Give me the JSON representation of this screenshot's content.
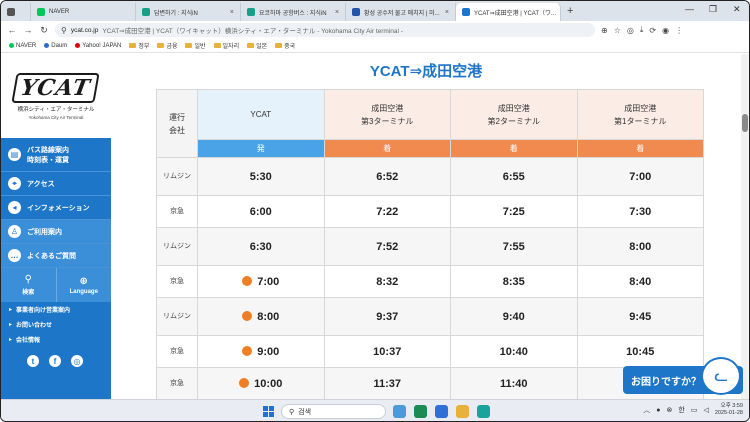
{
  "browser": {
    "tabs": [
      {
        "label": "",
        "favicon_color": "#555555"
      },
      {
        "label": "NAVER",
        "favicon_color": "#03c75a"
      },
      {
        "label": "답변하기 : 지식iN",
        "favicon_color": "#16a085"
      },
      {
        "label": "요코하마 공항버스 : 지식iN",
        "favicon_color": "#16a085"
      },
      {
        "label": "황성 공수저 물고 매치지 | 미...",
        "favicon_color": "#2255aa"
      },
      {
        "label": "YCAT⇒成田空港 | YCAT（ワ...",
        "favicon_color": "#1e76c8"
      }
    ],
    "address": {
      "domain": "ycat.co.jp",
      "rest": "YCAT⇒成田空港 | YCAT（ワイキャット）横浜シティ・エア・ターミナル - Yokohama City Air terminal -"
    },
    "bookmarks": [
      {
        "label": "NAVER",
        "icon": "dot",
        "color": "#03c75a"
      },
      {
        "label": "Daum",
        "icon": "dot",
        "color": "#2a6bd1"
      },
      {
        "label": "Yahoo! JAPAN",
        "icon": "dot",
        "color": "#e00000"
      },
      {
        "label": "정부",
        "icon": "folder"
      },
      {
        "label": "금융",
        "icon": "folder"
      },
      {
        "label": "일반",
        "icon": "folder"
      },
      {
        "label": "일자리",
        "icon": "folder"
      },
      {
        "label": "일본",
        "icon": "folder"
      },
      {
        "label": "중국",
        "icon": "folder"
      }
    ]
  },
  "sidebar": {
    "logo": {
      "mark": "YCAT",
      "jp": "横浜シティ・エア・ターミナル",
      "en": "Yokohama City Air Terminal"
    },
    "menu": [
      {
        "label_line1": "バス路線案内",
        "label_line2": "時刻表・運賃",
        "icon": "bus-icon",
        "glyph": "▤"
      },
      {
        "label_line1": "アクセス",
        "label_line2": "",
        "icon": "map-pin-icon",
        "glyph": "⌖"
      },
      {
        "label_line1": "インフォメーション",
        "label_line2": "",
        "icon": "megaphone-icon",
        "glyph": "◂"
      },
      {
        "label_line1": "ご利用案内",
        "label_line2": "",
        "icon": "person-icon",
        "glyph": "♙"
      },
      {
        "label_line1": "よくあるご質問",
        "label_line2": "",
        "icon": "chat-icon",
        "glyph": "…"
      }
    ],
    "search_label": "検索",
    "language_label": "Language",
    "links": [
      "事業者向け営業案内",
      "お問い合わせ",
      "会社情報"
    ]
  },
  "main": {
    "title": "YCAT⇒成田空港",
    "table": {
      "operator_header_line1": "運行",
      "operator_header_line2": "会社",
      "stops": [
        {
          "line1": "YCAT",
          "line2": ""
        },
        {
          "line1": "成田空港",
          "line2": "第3ターミナル"
        },
        {
          "line1": "成田空港",
          "line2": "第2ターミナル"
        },
        {
          "line1": "成田空港",
          "line2": "第1ターミナル"
        }
      ],
      "dep_label": "発",
      "arr_label": "着",
      "rows": [
        {
          "operator": "リムジン",
          "dot": false,
          "times": [
            "5:30",
            "6:52",
            "6:55",
            "7:00"
          ]
        },
        {
          "operator": "京急",
          "dot": false,
          "times": [
            "6:00",
            "7:22",
            "7:25",
            "7:30"
          ]
        },
        {
          "operator": "リムジン",
          "dot": false,
          "times": [
            "6:30",
            "7:52",
            "7:55",
            "8:00"
          ]
        },
        {
          "operator": "京急",
          "dot": true,
          "times": [
            "7:00",
            "8:32",
            "8:35",
            "8:40"
          ]
        },
        {
          "operator": "リムジン",
          "dot": true,
          "times": [
            "8:00",
            "9:37",
            "9:40",
            "9:45"
          ]
        },
        {
          "operator": "京急",
          "dot": true,
          "times": [
            "9:00",
            "10:37",
            "10:40",
            "10:45"
          ]
        },
        {
          "operator": "京急",
          "dot": true,
          "times": [
            "10:00",
            "11:37",
            "11:40",
            "11:45"
          ]
        }
      ]
    },
    "help_button": "お困りですか？"
  },
  "taskbar": {
    "search_placeholder": "검색",
    "ime": "한",
    "time": "오후 3:59",
    "date": "2025-01-28"
  }
}
